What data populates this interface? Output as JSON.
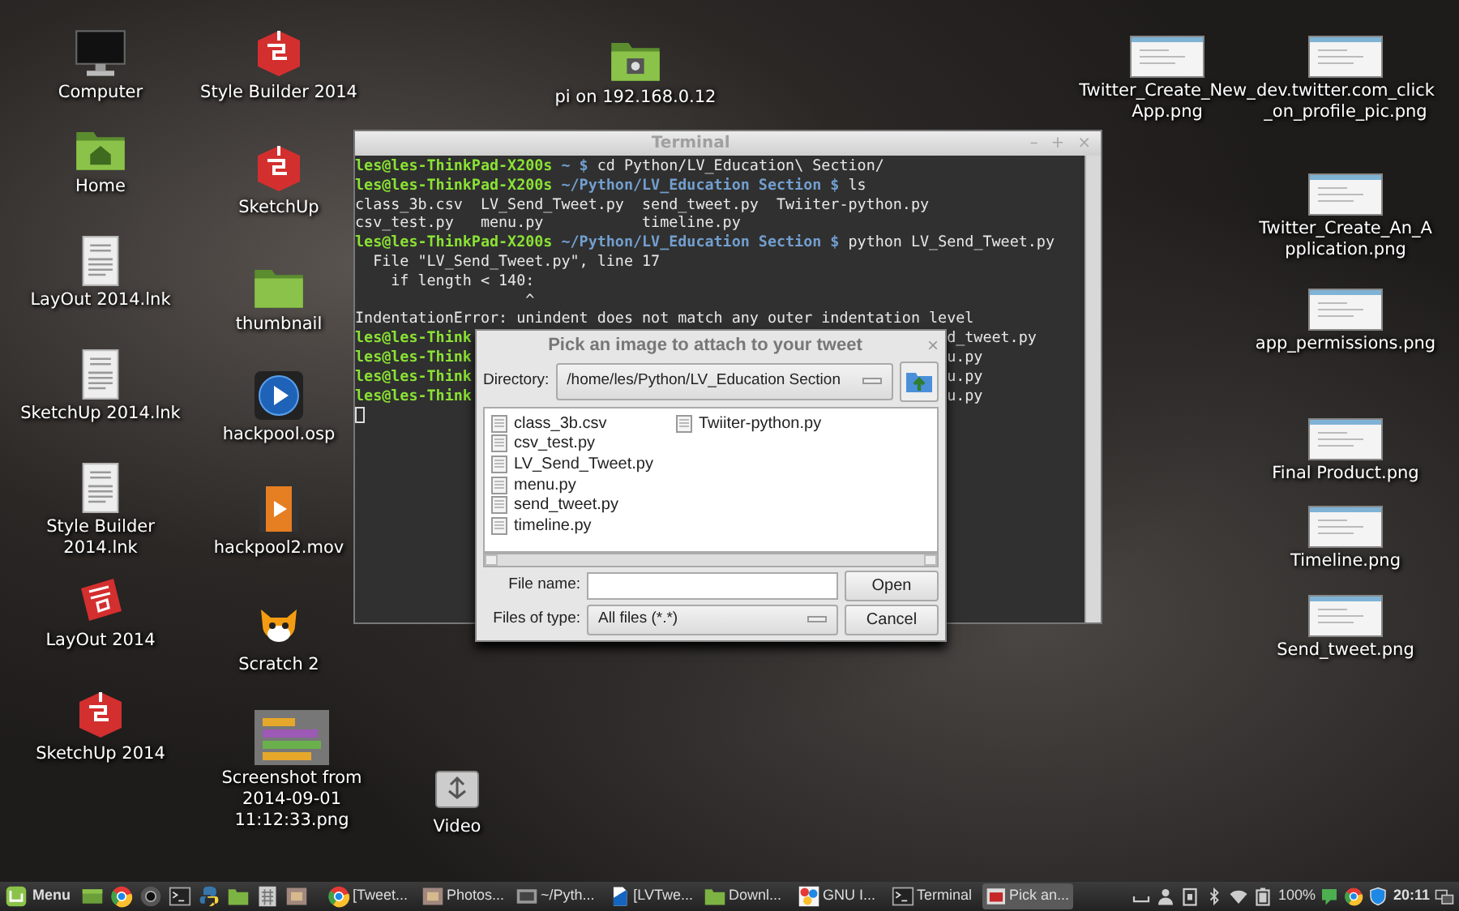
{
  "desktop": {
    "icons": [
      {
        "label": "Computer",
        "kind": "monitor"
      },
      {
        "label": "Style Builder 2014",
        "kind": "cube"
      },
      {
        "label": "pi on 192.168.0.12",
        "kind": "network-folder"
      },
      {
        "label": "Twitter_Create_New_App.png",
        "kind": "image"
      },
      {
        "label": "dev.twitter.com_click_on_profile_pic.png",
        "kind": "image"
      },
      {
        "label": "Home",
        "kind": "home-folder"
      },
      {
        "label": "SketchUp",
        "kind": "cube"
      },
      {
        "label": "Twitter_Create_An_Application.png",
        "kind": "image"
      },
      {
        "label": "LayOut 2014.lnk",
        "kind": "document"
      },
      {
        "label": "thumbnail",
        "kind": "folder"
      },
      {
        "label": "app_permissions.png",
        "kind": "image"
      },
      {
        "label": "SketchUp 2014.lnk",
        "kind": "document"
      },
      {
        "label": "hackpool.osp",
        "kind": "play"
      },
      {
        "label": "Final Product.png",
        "kind": "image"
      },
      {
        "label": "Style Builder 2014.lnk",
        "kind": "document"
      },
      {
        "label": "hackpool2.mov",
        "kind": "film"
      },
      {
        "label": "Timeline.png",
        "kind": "image"
      },
      {
        "label": "LayOut 2014",
        "kind": "page-logo"
      },
      {
        "label": "Scratch 2",
        "kind": "cat"
      },
      {
        "label": "Send_tweet.png",
        "kind": "image"
      },
      {
        "label": "SketchUp 2014",
        "kind": "cube"
      },
      {
        "label": "Screenshot from 2014-09-01 11:12:33.png",
        "kind": "blocks"
      },
      {
        "label": "Video",
        "kind": "usb"
      }
    ]
  },
  "terminal": {
    "title": "Terminal",
    "controls": [
      "–",
      "+",
      "×"
    ],
    "lines": [
      {
        "kind": "prompt",
        "user": "les@les-ThinkPad-X200s",
        "path": "~ $",
        "command": "cd Python/LV_Education\\ Section/"
      },
      {
        "kind": "prompt",
        "user": "les@les-ThinkPad-X200s",
        "path": "~/Python/LV_Education Section $",
        "command": "ls"
      },
      {
        "kind": "output",
        "text": "class_3b.csv  LV_Send_Tweet.py  send_tweet.py  Twiiter-python.py"
      },
      {
        "kind": "output",
        "text": "csv_test.py   menu.py           timeline.py"
      },
      {
        "kind": "prompt",
        "user": "les@les-ThinkPad-X200s",
        "path": "~/Python/LV_Education Section $",
        "command": "python LV_Send_Tweet.py"
      },
      {
        "kind": "output",
        "text": "  File \"LV_Send_Tweet.py\", line 17"
      },
      {
        "kind": "output",
        "text": "    if length < 140:"
      },
      {
        "kind": "output",
        "text": "                   ^"
      },
      {
        "kind": "output",
        "text": "IndentationError: unindent does not match any outer indentation level"
      },
      {
        "kind": "partial",
        "left": "les@les-Think",
        "right": "d_tweet.py"
      },
      {
        "kind": "partial",
        "left": "les@les-Think",
        "right": "u.py"
      },
      {
        "kind": "partial",
        "left": "les@les-Think",
        "right": "u.py"
      },
      {
        "kind": "partial",
        "left": "les@les-Think",
        "right": "u.py"
      },
      {
        "kind": "cursor"
      }
    ]
  },
  "dialog": {
    "title": "Pick an image to attach to your tweet",
    "close": "×",
    "directory_label": "Directory:",
    "directory": "/home/les/Python/LV_Education Section",
    "files": [
      "class_3b.csv",
      "csv_test.py",
      "LV_Send_Tweet.py",
      "menu.py",
      "send_tweet.py",
      "timeline.py",
      "Twiiter-python.py"
    ],
    "file_name_label": "File name:",
    "file_type_label": "Files of type:",
    "file_type": "All files (*.*)",
    "open_button": "Open",
    "cancel_button": "Cancel"
  },
  "taskbar": {
    "menu": "Menu",
    "launchers": [
      {
        "kind": "desktop"
      },
      {
        "kind": "browser"
      },
      {
        "kind": "camera"
      },
      {
        "kind": "terminal"
      },
      {
        "kind": "python"
      },
      {
        "kind": "folder"
      },
      {
        "kind": "calculator"
      },
      {
        "kind": "viewer"
      }
    ],
    "tasks": [
      {
        "label": "[Tweet...",
        "kind": "browser",
        "selected": false
      },
      {
        "label": "Photos...",
        "kind": "viewer",
        "selected": false
      },
      {
        "label": "~/Pyth...",
        "kind": "editor",
        "selected": false
      },
      {
        "label": "[LVTwe...",
        "kind": "document",
        "selected": false
      },
      {
        "label": "Downl...",
        "kind": "folder",
        "selected": false
      },
      {
        "label": "GNU I...",
        "kind": "paint",
        "selected": false
      },
      {
        "label": "Terminal",
        "kind": "terminal",
        "selected": false
      },
      {
        "label": "Pick an...",
        "kind": "dialog",
        "selected": true
      }
    ],
    "tray": [
      {
        "kind": "keyboard"
      },
      {
        "kind": "user"
      },
      {
        "kind": "clipboard"
      },
      {
        "kind": "bluetooth"
      },
      {
        "kind": "wifi"
      },
      {
        "kind": "battery",
        "text": "100%"
      },
      {
        "kind": "chat"
      },
      {
        "kind": "browser"
      },
      {
        "kind": "shield"
      },
      {
        "kind": "clock",
        "text": "20:11"
      },
      {
        "kind": "workspace"
      }
    ]
  }
}
